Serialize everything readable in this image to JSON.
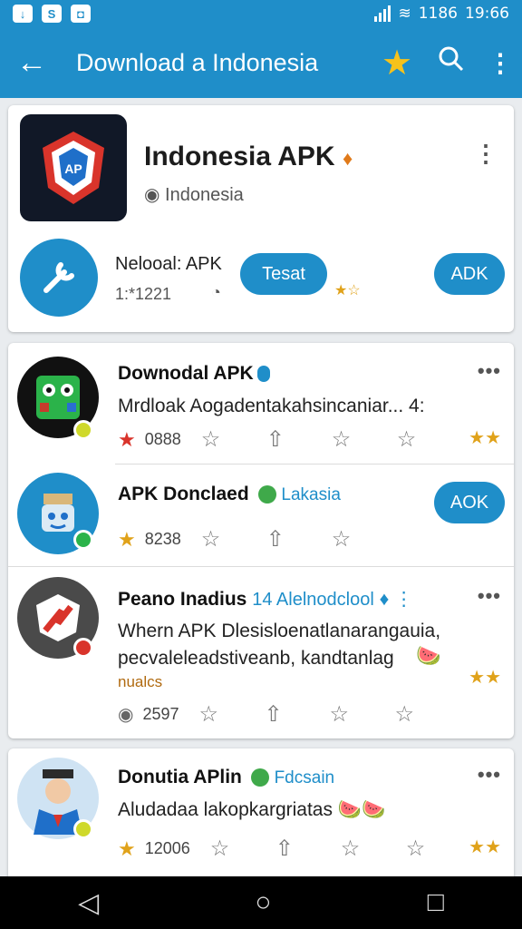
{
  "status": {
    "battery": "1186",
    "time": "19:66"
  },
  "appbar": {
    "title": "Download a Indonesia"
  },
  "featured": {
    "title": "Indonesia APK",
    "subtitle": "Indonesia",
    "row_name": "Nelooal: APK",
    "row_meta": "1:*1221",
    "install_label": "Tesat",
    "apk_label": "ADK"
  },
  "list": [
    {
      "name": "Downodal APK",
      "desc": "Mrdloak Aogadentakahsincaniar... 4:",
      "count": "0888"
    },
    {
      "name": "APK Donclaed",
      "tag": "Lakasia",
      "count": "8238",
      "apk_label": "AOK"
    },
    {
      "name": "Peano Inadius",
      "tag": "14 Alelnodclool",
      "desc1": "Whern APK Dlesisloenatlanarangauia,",
      "desc2": "pecvaleleadstiveanb, kandtanlag",
      "desc3": "nualcs",
      "count": "2597"
    },
    {
      "name": "Donutia APlin",
      "tag": "Fdcsain",
      "desc": "Aludadaa lakopkargriatas",
      "count": "12006"
    }
  ],
  "colors": {
    "primary": "#1f8ec9",
    "accent_star": "#f6c21b"
  }
}
